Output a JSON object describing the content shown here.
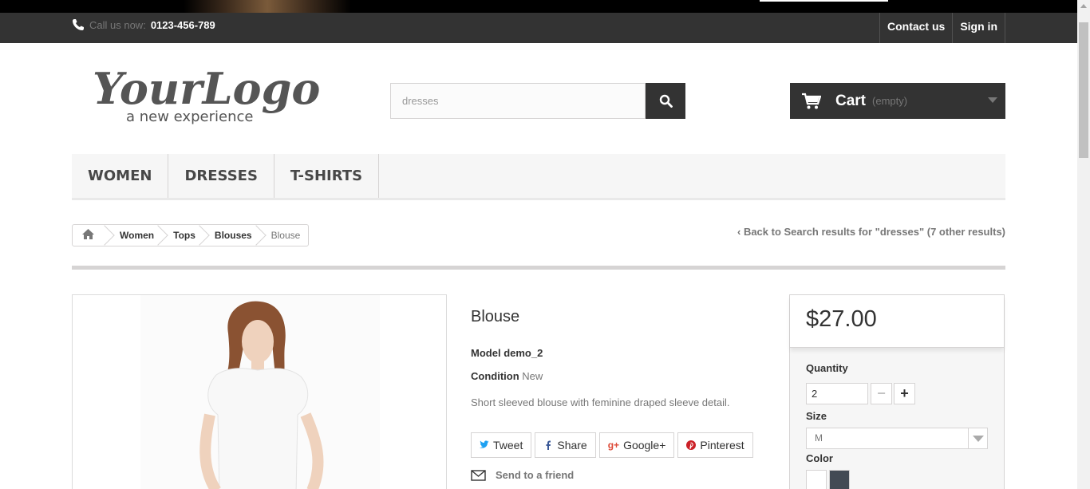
{
  "topbar": {
    "call_label": "Call us now:",
    "phone": "0123-456-789",
    "contact_label": "Contact us",
    "signin_label": "Sign in"
  },
  "header": {
    "logo_main": "YourLogo",
    "logo_tagline": "a new experience",
    "search_value": "dresses",
    "cart_label": "Cart",
    "cart_state": "(empty)"
  },
  "menu": {
    "items": [
      "WOMEN",
      "DRESSES",
      "T-SHIRTS"
    ]
  },
  "breadcrumb": {
    "items": [
      "Women",
      "Tops",
      "Blouses",
      "Blouse"
    ],
    "back_link": "Back to Search results for \"dresses\" (7 other results)"
  },
  "product": {
    "name": "Blouse",
    "model_label": "Model",
    "model_value": "demo_2",
    "condition_label": "Condition",
    "condition_value": "New",
    "description": "Short sleeved blouse with feminine draped sleeve detail.",
    "share": {
      "tweet": "Tweet",
      "share": "Share",
      "google": "Google+",
      "pinterest": "Pinterest"
    },
    "send_friend": "Send to a friend"
  },
  "buy": {
    "price": "$27.00",
    "quantity_label": "Quantity",
    "quantity_value": "2",
    "size_label": "Size",
    "size_value": "M",
    "color_label": "Color",
    "colors": [
      "#ffffff",
      "#434a54"
    ]
  },
  "colors": {
    "dark": "#333333",
    "accent_twitter": "#1da1f2",
    "accent_google": "#dd4b39",
    "accent_pinterest": "#cb2027"
  }
}
